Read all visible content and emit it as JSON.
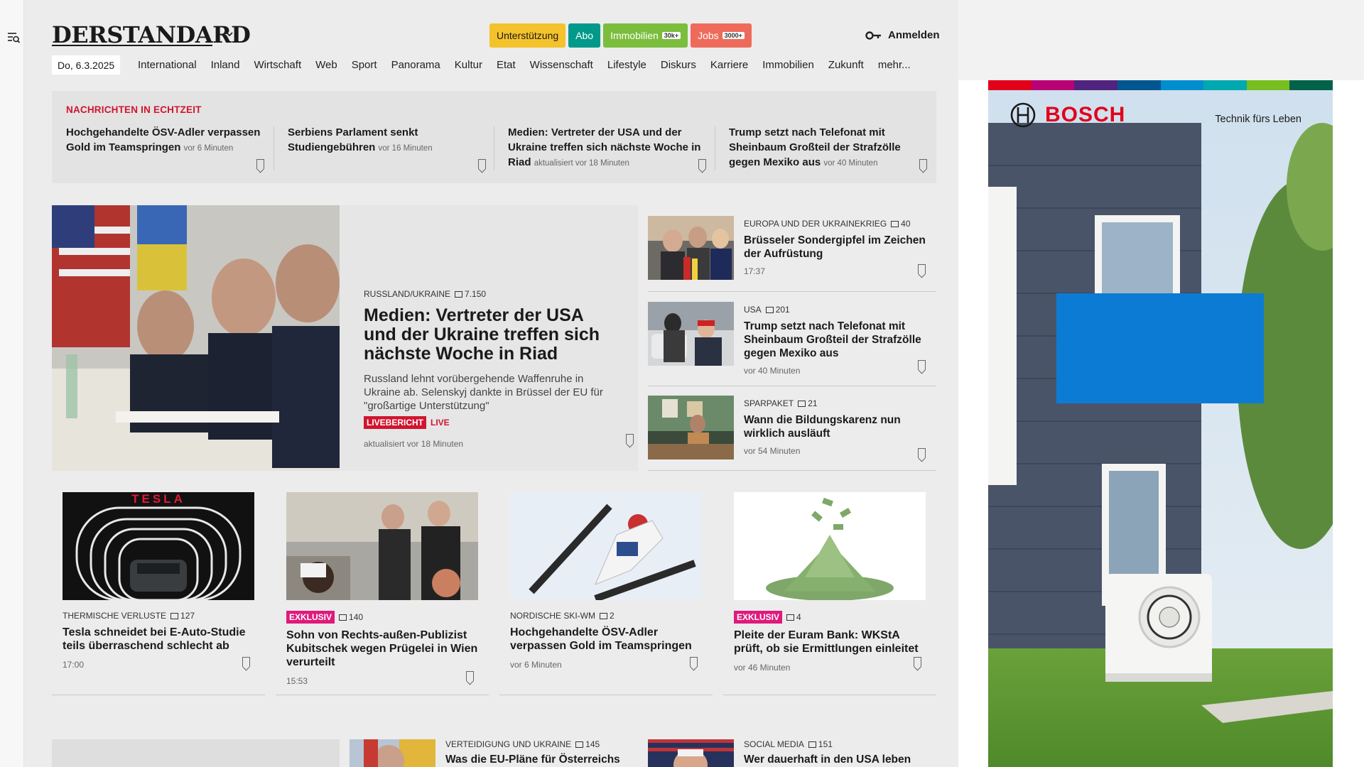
{
  "header": {
    "logo_text": "DERSTANDARD",
    "buttons": [
      {
        "label": "Unterstützung",
        "bg": "#f4c22b",
        "color": "#1a1a1a",
        "badge": ""
      },
      {
        "label": "Abo",
        "bg": "#00998a",
        "color": "#ffffff",
        "badge": ""
      },
      {
        "label": "Immobilien",
        "bg": "#7bbd3c",
        "color": "#ffffff",
        "badge": "30k+"
      },
      {
        "label": "Jobs",
        "bg": "#ee6b5c",
        "color": "#ffffff",
        "badge": "3000+"
      }
    ],
    "login_label": "Anmelden",
    "date": "Do, 6.3.2025",
    "nav": [
      "International",
      "Inland",
      "Wirtschaft",
      "Web",
      "Sport",
      "Panorama",
      "Kultur",
      "Etat",
      "Wissenschaft",
      "Lifestyle",
      "Diskurs",
      "Karriere",
      "Immobilien",
      "Zukunft",
      "mehr..."
    ]
  },
  "ticker": {
    "label": "NACHRICHTEN IN ECHTZEIT",
    "items": [
      {
        "title": "Hochgehandelte ÖSV-Adler verpassen Gold im Teamspringen",
        "time": "vor 6 Minuten"
      },
      {
        "title": "Serbiens Parlament senkt Studiengebühren",
        "time": "vor 16 Minuten"
      },
      {
        "title": "Medien: Vertreter der USA und der Ukraine treffen sich nächste Woche in Riad",
        "time": "aktualisiert vor 18 Minuten"
      },
      {
        "title": "Trump setzt nach Telefonat mit Sheinbaum Großteil der Strafzölle gegen Mexiko aus",
        "time": "vor 40 Minuten"
      }
    ]
  },
  "lead": {
    "kicker": "RUSSLAND/UKRAINE",
    "comments": "7.150",
    "title": "Medien: Vertreter der USA und der Ukraine treffen sich nächste Woche in Riad",
    "subtitle": "Russland lehnt vorübergehende Waffenruhe in Ukraine ab. Selenskyj dankte in Brüssel der EU für \"großartige Unterstützung\"",
    "live_badge": "LIVEBERICHT",
    "live_text": "LIVE",
    "time": "aktualisiert vor 18 Minuten"
  },
  "side_stories": [
    {
      "kicker": "EUROPA UND DER UKRAINEKRIEG",
      "comments": "40",
      "title": "Brüsseler Sondergipfel im Zeichen der Aufrüstung",
      "time": "17:37"
    },
    {
      "kicker": "USA",
      "comments": "201",
      "title": "Trump setzt nach Telefonat mit Sheinbaum Großteil der Strafzölle gegen Mexiko aus",
      "time": "vor 40 Minuten"
    },
    {
      "kicker": "SPARPAKET",
      "comments": "21",
      "title": "Wann die Bildungskarenz nun wirklich ausläuft",
      "time": "vor 54 Minuten"
    }
  ],
  "cards": [
    {
      "kicker": "THERMISCHE VERLUSTE",
      "badge": "",
      "comments": "127",
      "title": "Tesla schneidet bei E-Auto-Studie teils überraschend schlecht ab",
      "time": "17:00",
      "img_text": "TESLA"
    },
    {
      "kicker": "",
      "badge": "EXKLUSIV",
      "comments": "140",
      "title": "Sohn von Rechts-außen-Publizist Kubitschek wegen Prügelei in Wien verurteilt",
      "time": "15:53"
    },
    {
      "kicker": "NORDISCHE SKI-WM",
      "badge": "",
      "comments": "2",
      "title": "Hochgehandelte ÖSV-Adler verpassen Gold im Teamspringen",
      "time": "vor 6 Minuten"
    },
    {
      "kicker": "",
      "badge": "EXKLUSIV",
      "comments": "4",
      "title": "Pleite der Euram Bank: WKStA prüft, ob sie Ermittlungen einleitet",
      "time": "vor 46 Minuten"
    }
  ],
  "bottom": [
    {
      "kicker": "VERTEIDIGUNG UND UKRAINE",
      "comments": "145",
      "title": "Was die EU-Pläne für Österreichs"
    },
    {
      "kicker": "SOCIAL MEDIA",
      "comments": "151",
      "title": "Wer dauerhaft in den USA leben"
    }
  ],
  "ad": {
    "brand": "BOSCH",
    "tagline": "Technik fürs Leben",
    "stripe_colors": [
      "#e2001a",
      "#b90276",
      "#50237f",
      "#005691",
      "#008ecf",
      "#00a8b0",
      "#78be20",
      "#006249"
    ]
  }
}
